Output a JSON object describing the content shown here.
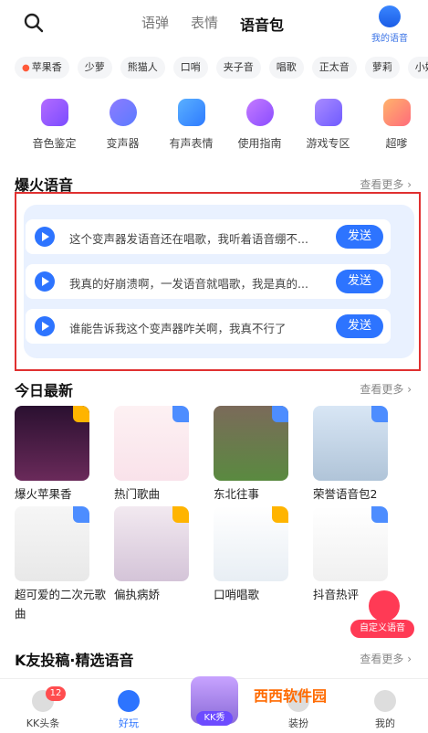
{
  "header": {
    "tabs": [
      "语弹",
      "表情",
      "语音包"
    ],
    "active_tab": "语音包",
    "my_voice_label": "我的语音"
  },
  "chips": [
    "苹果香",
    "少萝",
    "熊猫人",
    "口哨",
    "夹子音",
    "唱歌",
    "正太音",
    "萝莉",
    "小奶"
  ],
  "shortcuts": [
    "音色鉴定",
    "变声器",
    "有声表情",
    "使用指南",
    "游戏专区",
    "超嗲"
  ],
  "hot_section": {
    "title": "爆火语音",
    "more": "查看更多",
    "items": [
      {
        "text": "这个变声器发语音还在唱歌，我听着语音绷不...",
        "button": "发送"
      },
      {
        "text": "我真的好崩溃啊，一发语音就唱歌，我是真的...",
        "button": "发送"
      },
      {
        "text": "谁能告诉我这个变声器咋关啊，我真不行了",
        "button": "发送"
      }
    ]
  },
  "today_section": {
    "title": "今日最新",
    "more": "查看更多",
    "items": [
      {
        "label": "爆火苹果香",
        "badge": "crown"
      },
      {
        "label": "热门歌曲",
        "badge": "lock"
      },
      {
        "label": "东北往事",
        "badge": "lock"
      },
      {
        "label": "荣誉语音包2",
        "badge": "lock"
      },
      {
        "label": "超可爱的二次元歌",
        "badge": "lock"
      },
      {
        "label": "偏执病娇",
        "badge": "crown"
      },
      {
        "label": "口哨唱歌",
        "badge": "crown"
      },
      {
        "label": "抖音热评",
        "badge": "lock"
      }
    ],
    "custom_voice_label": "自定义语音",
    "second_line": "曲"
  },
  "picks_section": {
    "title": "K友投稿·精选语音",
    "more": "查看更多"
  },
  "bottom_nav": {
    "items": [
      "KK头条",
      "好玩",
      "KK秀",
      "装扮",
      "我的"
    ],
    "active": "好玩",
    "notification_count": "12"
  },
  "watermark": "西西软件园"
}
